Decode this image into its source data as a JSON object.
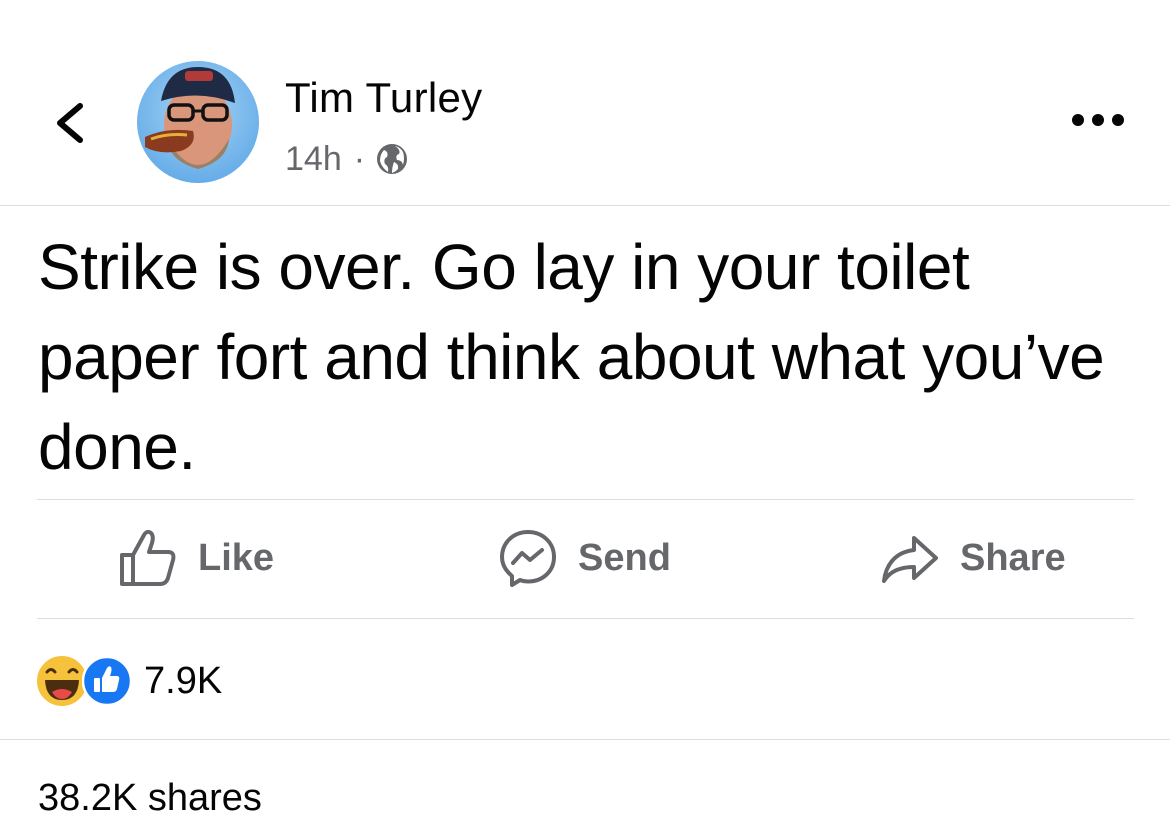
{
  "post": {
    "author": "Tim Turley",
    "time": "14h",
    "separator": "·",
    "privacy_icon": "globe-icon",
    "text": "Strike is over. Go lay in your toilet paper fort and think about what you’ve done."
  },
  "header": {
    "back_icon": "chevron-left-icon",
    "more_icon": "more-horizontal-icon"
  },
  "actions": {
    "like_label": "Like",
    "send_label": "Send",
    "share_label": "Share"
  },
  "engagement": {
    "reactions": [
      "haha",
      "like"
    ],
    "reaction_count": "7.9K",
    "shares": "38.2K shares"
  },
  "colors": {
    "text": "#050505",
    "secondary": "#65676b",
    "divider": "#dadde1",
    "like_blue": "#1877f2",
    "haha_yellow": "#f7c23b"
  }
}
